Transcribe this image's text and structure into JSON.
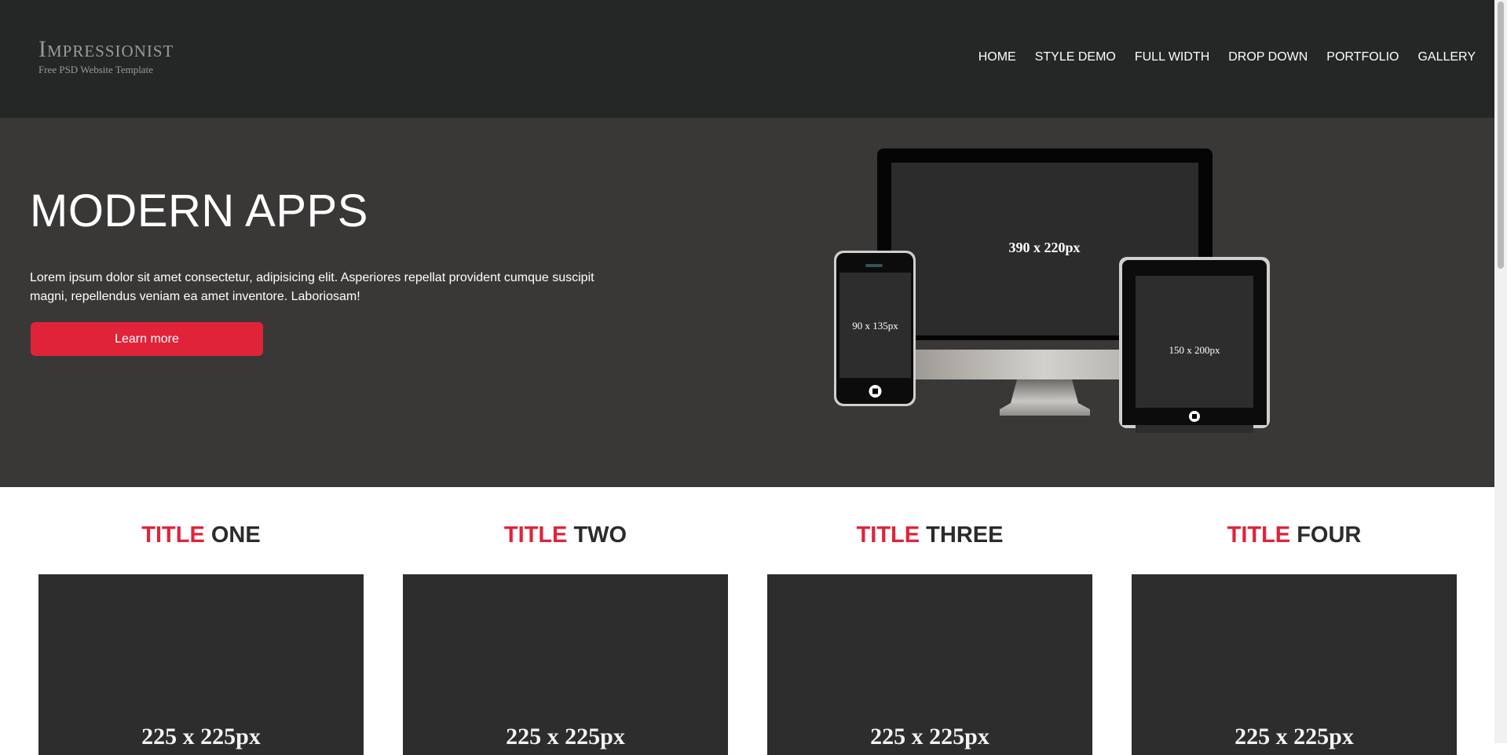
{
  "header": {
    "logo_title": "Impressionist",
    "logo_subtitle": "Free PSD Website Template",
    "nav": [
      {
        "label": "HOME"
      },
      {
        "label": "STYLE DEMO"
      },
      {
        "label": "FULL WIDTH"
      },
      {
        "label": "DROP DOWN"
      },
      {
        "label": "PORTFOLIO"
      },
      {
        "label": "GALLERY"
      }
    ]
  },
  "hero": {
    "title": "MODERN APPS",
    "text": "Lorem ipsum dolor sit amet consectetur, adipisicing elit. Asperiores repellat provident cumque suscipit magni, repellendus veniam ea amet inventore. Laboriosam!",
    "button_label": "Learn more",
    "devices": {
      "desktop_label": "390 x 220px",
      "phone_label": "90 x 135px",
      "tablet_label": "150 x 200px"
    }
  },
  "services": [
    {
      "accent": "TITLE",
      "rest": "ONE",
      "image_label": "225 x 225px"
    },
    {
      "accent": "TITLE",
      "rest": "TWO",
      "image_label": "225 x 225px"
    },
    {
      "accent": "TITLE",
      "rest": "THREE",
      "image_label": "225 x 225px"
    },
    {
      "accent": "TITLE",
      "rest": "FOUR",
      "image_label": "225 x 225px"
    }
  ],
  "colors": {
    "header_bg": "#252626",
    "hero_bg": "#3a3837",
    "accent": "#e1233a",
    "placeholder_bg": "#2d2d2d"
  }
}
